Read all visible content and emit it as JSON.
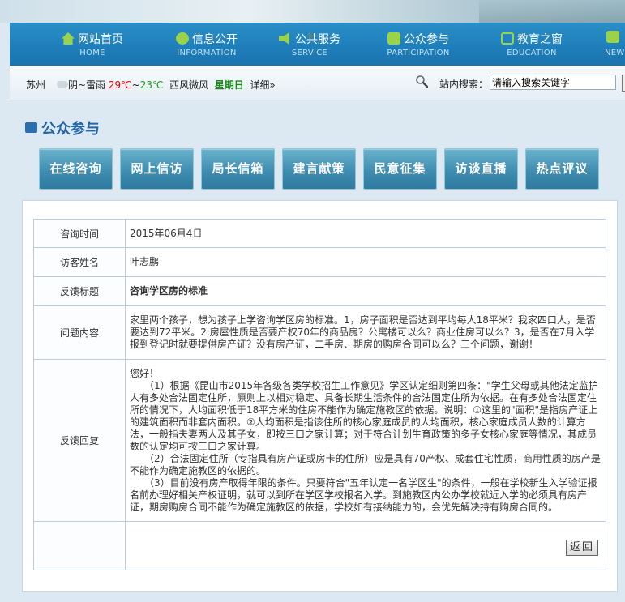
{
  "nav": [
    {
      "cn": "网站首页",
      "en": "HOME",
      "icon": "home-icon"
    },
    {
      "cn": "信息公开",
      "en": "INFORMATION",
      "icon": "chat-bubble-icon"
    },
    {
      "cn": "公共服务",
      "en": "SERVICE",
      "icon": "speaker-icon"
    },
    {
      "cn": "公众参与",
      "en": "PARTICIPATION",
      "icon": "message-icon"
    },
    {
      "cn": "教育之窗",
      "en": "EDUCATION",
      "icon": "edit-icon"
    },
    {
      "cn": "",
      "en": "NEW",
      "icon": "news-icon"
    }
  ],
  "infobar": {
    "city": "苏州",
    "weather": "阴~雷雨",
    "temp_high": "29℃",
    "temp_sep": "~",
    "temp_low": "23℃",
    "wind": "西风微风",
    "weekday": "星期日",
    "detail_link": "详细»",
    "search_label": "站内搜索：",
    "search_value": "请输入搜索关键字"
  },
  "section": {
    "title": "公众参与"
  },
  "subnav": [
    "在线咨询",
    "网上信访",
    "局长信箱",
    "建言献策",
    "民意征集",
    "访谈直播",
    "热点评议"
  ],
  "detail": {
    "time_label": "咨询时间",
    "time_value": "2015年06月4日",
    "visitor_label": "访客姓名",
    "visitor_value": "叶志鹏",
    "title_label": "反馈标题",
    "title_value": "咨询学区房的标准",
    "question_label": "问题内容",
    "question_value": "家里两个孩子，想为孩子上学咨询学区房的标准。1，房子面积是否达到平均每人18平米？我家四口人，是否要达到72平米。2,房屋性质是否要产权70年的商品房？公寓楼可以么？商业住房可以么？3，是否在7月入学报到登记时就要提供房产证？没有房产证，二手房、期房的购房合同可以么？三个问题，谢谢！",
    "reply_label": "反馈回复",
    "reply_value": "您好！\n　　（1）根据《昆山市2015年各级各类学校招生工作意见》学区认定细则第四条：\"学生父母或其他法定监护人有多处合法固定住所，原则上以相对稳定、具备长期生活条件的合法固定住所为依据。在有多处合法固定住所的情况下，人均面积低于18平方米的住房不能作为确定施教区的依据。说明：①这里的\"面积\"是指房产证上的建筑面积而非套内面积。②人均面积是指该住所的核心家庭成员的人均面积，核心家庭成员人数的计算方法，一般指夫妻两人及其子女，即按三口之家计算；对于符合计划生育政策的多子女核心家庭等情况，其成员数的认定均可按三口之家计算。\n　　（2）合法固定住所（专指具有房产证或房卡的住所）应是具有70产权、成套住宅性质，商用性质的房产是不能作为确定施教区的依据的。\n　　（3）目前没有房产取得年限的条件。只要符合\"五年认定一名学区生\"的条件，一般在学校新生入学验证报名前办理好相关产权证明，就可以到所在学区学校报名入学。到施教区内公办学校就近入学的必须具有房产证，期房购房合同不能作为确定施教区的依据，学校如有接纳能力的，会优先解决持有购房合同的。",
    "back_button": "返回"
  }
}
